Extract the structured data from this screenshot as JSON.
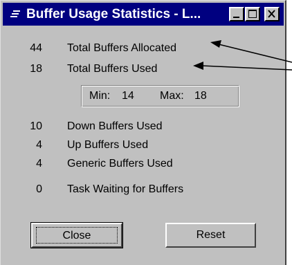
{
  "window": {
    "title": "Buffer Usage Statistics - L...",
    "controls": {
      "minimize": "minimize-icon",
      "maximize": "maximize-icon",
      "close": "close-icon"
    }
  },
  "stats": {
    "allocated": {
      "value": "44",
      "label": "Total Buffers Allocated"
    },
    "used": {
      "value": "18",
      "label": "Total Buffers Used"
    },
    "min_label": "Min:",
    "min_value": "14",
    "max_label": "Max:",
    "max_value": "18",
    "down": {
      "value": "10",
      "label": "Down Buffers Used"
    },
    "up": {
      "value": "4",
      "label": "Up  Buffers Used"
    },
    "generic": {
      "value": "4",
      "label": "Generic Buffers Used"
    },
    "waiting": {
      "value": "0",
      "label": "Task Waiting for Buffers"
    }
  },
  "buttons": {
    "close": "Close",
    "reset": "Reset"
  },
  "colors": {
    "titlebar": "#000080",
    "face": "#c0c0c0"
  }
}
